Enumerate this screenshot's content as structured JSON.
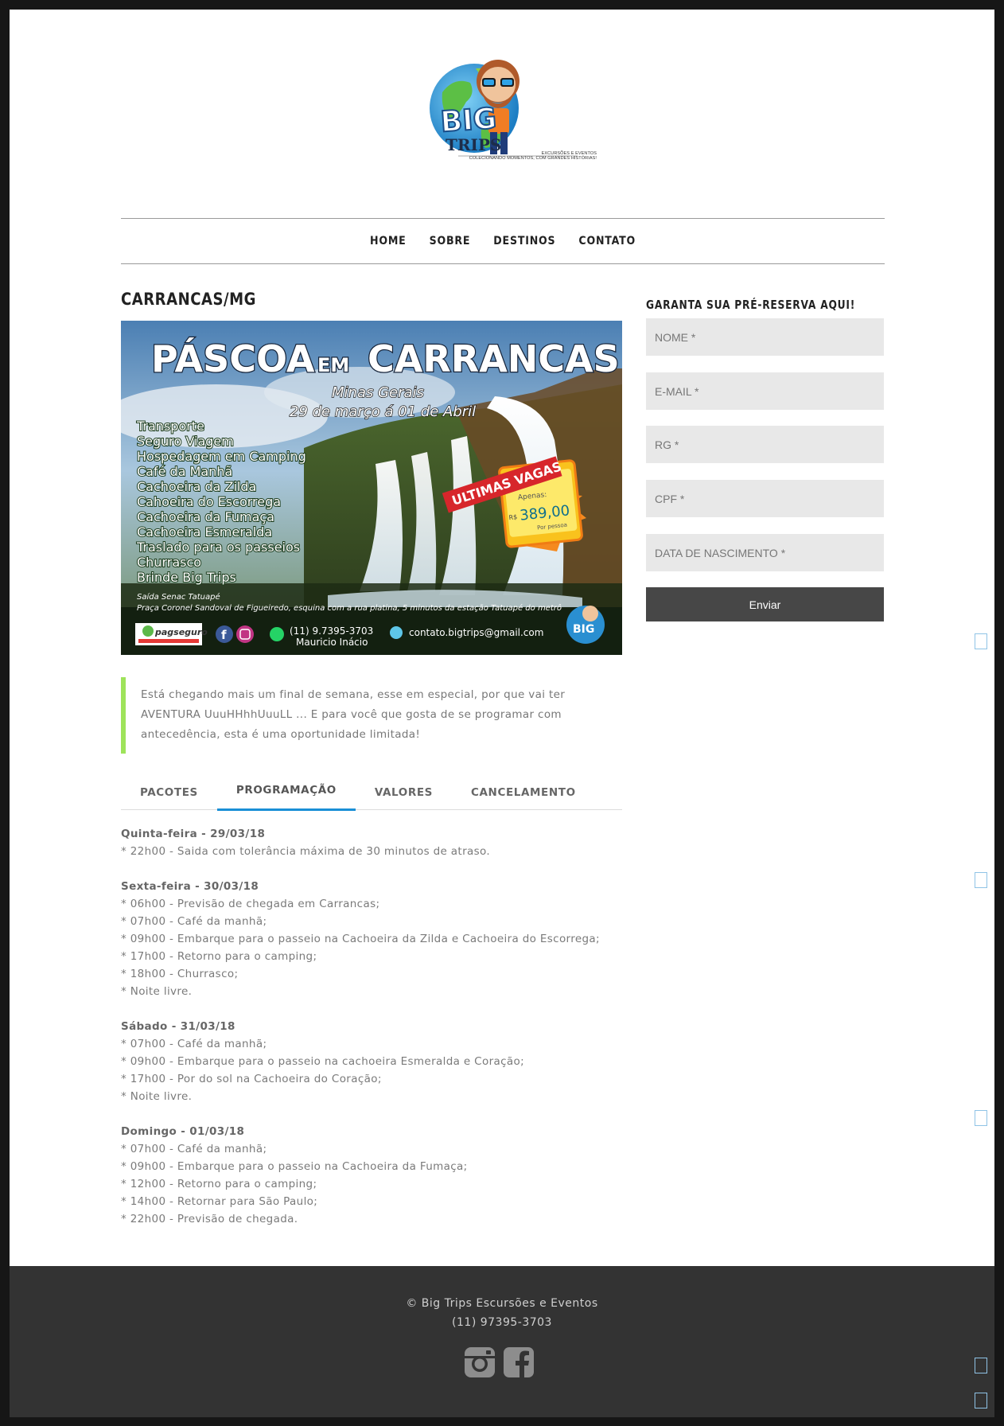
{
  "logo": {
    "brand_big": "BIG",
    "brand_trips": "TRIPS",
    "tagline_1": "EXCURSÕES E EVENTOS",
    "tagline_2": "COLECIONANDO MOMENTOS, COM GRANDES HISTÓRIAS!"
  },
  "nav": {
    "items": [
      "HOME",
      "SOBRE",
      "DESTINOS",
      "CONTATO"
    ]
  },
  "page": {
    "title": "CARRANCAS/MG"
  },
  "poster": {
    "headline_1": "PÁSCOA",
    "headline_em": "EM",
    "headline_2": "CARRANCAS",
    "subtitle": "Minas Gerais",
    "dates": "29 de março á 01 de Abril",
    "features": [
      "Transporte",
      "Seguro Viagem",
      "Hospedagem em Camping",
      "Café da Manhã",
      "Cachoeira da Zilda",
      "Cahoeira do Escorrega",
      "Cachoeira da Fumaça",
      "Cachoeira Esmeralda",
      "Traslado para os passeios",
      "Churrasco",
      "Brinde Big Trips"
    ],
    "badge_ribbon": "ULTIMAS VAGAS",
    "badge_apenas": "Apenas:",
    "badge_currency": "R$",
    "badge_price": "389,00",
    "badge_per": "Por pessoa",
    "departure_1": "Saída Senac Tatuapé",
    "departure_2": "Praça Coronel Sandoval de Figueiredo, esquina com a rua platina, 5 minutos da estação Tatuapé do metrô",
    "pagseguro": "pagseguro",
    "phone": "(11) 9.7395-3703",
    "contact_name": "Mauricio Inácio",
    "email": "contato.bigtrips@gmail.com"
  },
  "intro": {
    "text": "Está chegando mais um final de semana, esse em especial, por que vai ter AVENTURA UuuHHhhUuuLL ... E para você que gosta de se programar com antecedência, esta é uma oportunidade limitada!"
  },
  "tabs": [
    {
      "label": "PACOTES",
      "active": false
    },
    {
      "label": "PROGRAMAÇÃO",
      "active": true
    },
    {
      "label": "VALORES",
      "active": false
    },
    {
      "label": "CANCELAMENTO",
      "active": false
    }
  ],
  "schedule": [
    {
      "day": "Quinta-feira - 29/03/18",
      "items": [
        "* 22h00 - Saida com tolerância máxima de 30 minutos de atraso."
      ]
    },
    {
      "day": "Sexta-feira - 30/03/18",
      "items": [
        "* 06h00 - Previsão de chegada em Carrancas;",
        "* 07h00 - Café da manhã;",
        "* 09h00 - Embarque para o passeio na Cachoeira da Zilda e Cachoeira do Escorrega;",
        "* 17h00 - Retorno para o camping;",
        "* 18h00 - Churrasco;",
        "* Noite livre."
      ]
    },
    {
      "day": "Sábado - 31/03/18",
      "items": [
        "* 07h00 - Café da manhã;",
        "* 09h00 - Embarque para o passeio na cachoeira Esmeralda e Coração;",
        "* 17h00 - Por do sol na Cachoeira do Coração;",
        "* Noite livre."
      ]
    },
    {
      "day": "Domingo - 01/03/18",
      "items": [
        "* 07h00 - Café da manhã;",
        "* 09h00 - Embarque para o passeio na Cachoeira da Fumaça;",
        "* 12h00 - Retorno para o camping;",
        "* 14h00 - Retornar para São Paulo;",
        "* 22h00 - Previsão de chegada."
      ]
    }
  ],
  "sidebar": {
    "title": "GARANTA SUA PRÉ-RESERVA AQUI!",
    "fields": {
      "nome": "NOME *",
      "email": "E-MAIL *",
      "rg": "RG *",
      "cpf": "CPF *",
      "nascimento": "DATA DE NASCIMENTO *"
    },
    "submit": "Enviar"
  },
  "footer": {
    "copyright": "© Big Trips Escursões e Eventos",
    "phone": "(11) 97395-3703",
    "icons": [
      "instagram-icon",
      "facebook-icon"
    ]
  },
  "colors": {
    "accent_tab": "#1a8fd6",
    "quote_border": "#9ee35a",
    "button": "#474747",
    "footer": "#333333",
    "field": "#e8e8e8"
  }
}
